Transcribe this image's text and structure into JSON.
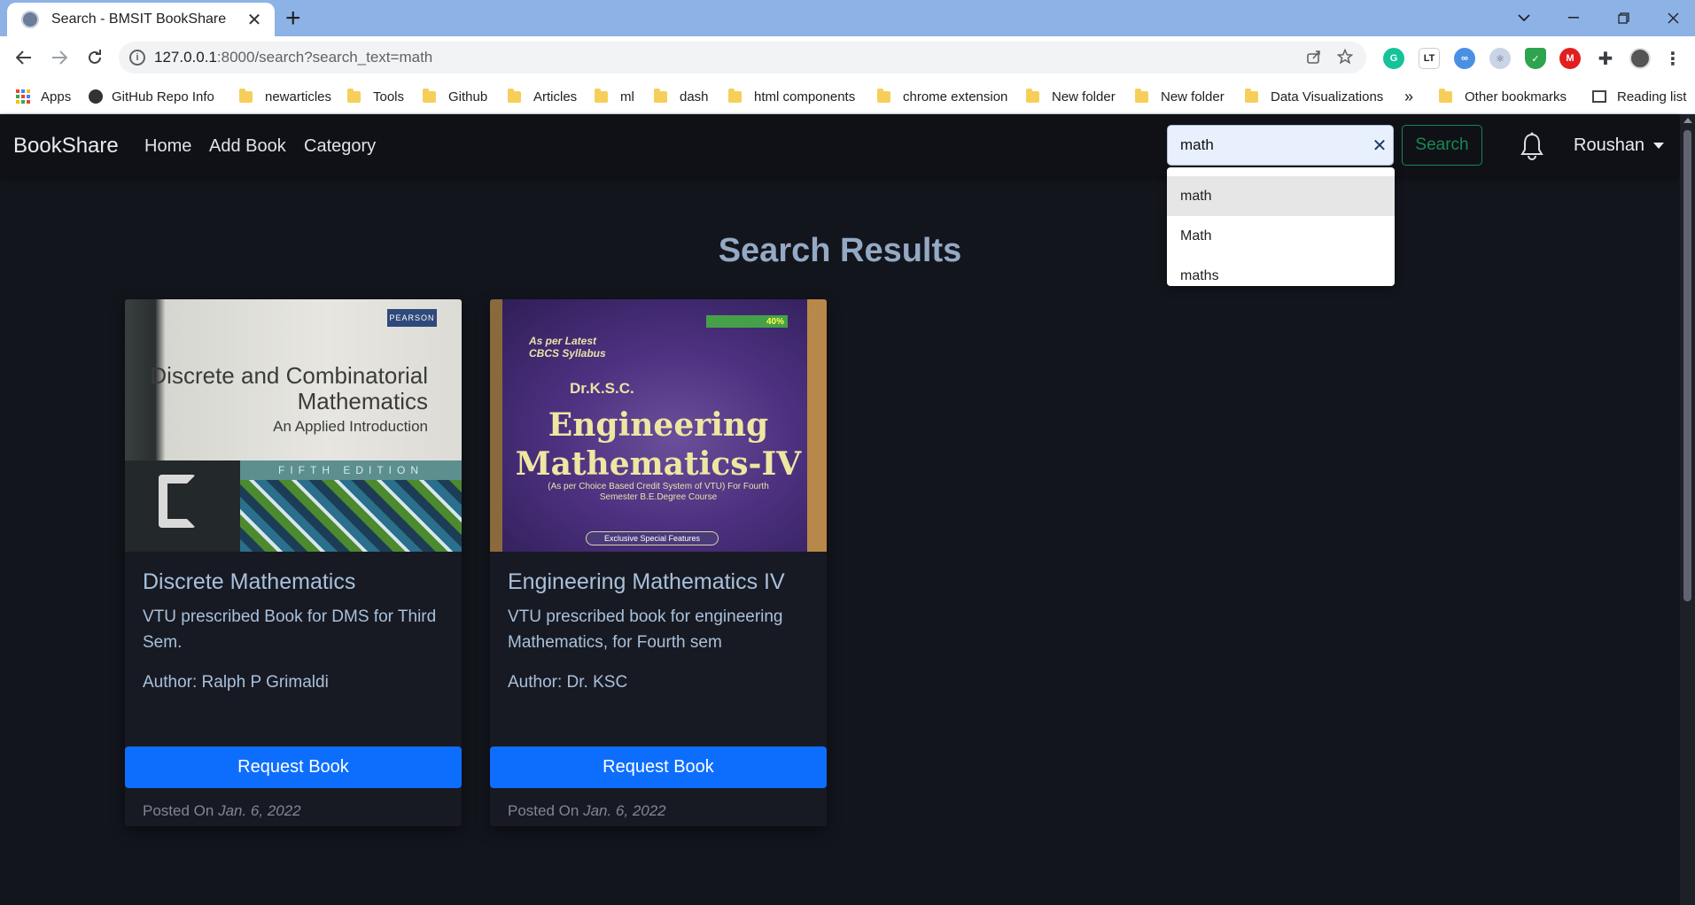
{
  "browser": {
    "tab_title": "Search - BMSIT BookShare",
    "tab_close": "✕",
    "new_tab": "+",
    "url_host": "127.0.0.1",
    "url_rest": ":8000/search?search_text=math",
    "bookmarks": [
      {
        "label": "Apps",
        "icon": "apps-grid-icon"
      },
      {
        "label": "GitHub Repo Info",
        "icon": "globe-icon"
      },
      {
        "label": "newarticles",
        "icon": "folder-icon"
      },
      {
        "label": "Tools",
        "icon": "folder-icon"
      },
      {
        "label": "Github",
        "icon": "folder-icon"
      },
      {
        "label": "Articles",
        "icon": "folder-icon"
      },
      {
        "label": "ml",
        "icon": "folder-icon"
      },
      {
        "label": "dash",
        "icon": "folder-icon"
      },
      {
        "label": "html components",
        "icon": "folder-icon"
      },
      {
        "label": "chrome extension",
        "icon": "folder-icon"
      },
      {
        "label": "New folder",
        "icon": "folder-icon"
      },
      {
        "label": "New folder",
        "icon": "folder-icon"
      },
      {
        "label": "Data Visualizations",
        "icon": "folder-icon"
      }
    ],
    "bookmarks_overflow": "»",
    "other_bookmarks": "Other bookmarks",
    "reading_list": "Reading list"
  },
  "navbar": {
    "brand": "BookShare",
    "links": [
      "Home",
      "Add Book",
      "Category"
    ],
    "search_value": "math",
    "search_clear": "✕",
    "search_button": "Search",
    "user_name": "Roushan"
  },
  "autocomplete": [
    "math",
    "Math",
    "maths"
  ],
  "page": {
    "title": "Search Results"
  },
  "books": [
    {
      "title": "Discrete Mathematics",
      "description": "VTU prescribed Book for DMS for Third Sem.",
      "author": "Author: Ralph P Grimaldi",
      "button": "Request Book",
      "posted_label": "Posted On",
      "posted_date": "Jan. 6, 2022",
      "cover": {
        "publisher": "PEARSON",
        "title": "Discrete and Combinatorial Mathematics",
        "subtitle": "An Applied Introduction",
        "edition": "FIFTH EDITION"
      }
    },
    {
      "title": "Engineering Mathematics IV",
      "description": "VTU prescribed book for engineering Mathematics, for Fourth sem",
      "author": "Author: Dr. KSC",
      "button": "Request Book",
      "posted_label": "Posted On",
      "posted_date": "Jan. 6, 2022",
      "cover": {
        "badge": "40%",
        "tagline": "As per Latest CBCS Syllabus",
        "author_line": "Dr.K.S.C.",
        "title": "Engineering Mathematics-IV",
        "subtitle": "(As per Choice Based Credit System of VTU) For Fourth Semester B.E.Degree Course",
        "feature": "Exclusive Special Features"
      }
    }
  ],
  "colors": {
    "page_bg": "#13151d",
    "navbar_bg": "#0f1116",
    "accent_blue": "#0d6efd",
    "search_green": "#198754",
    "heading": "#93a9c4"
  }
}
